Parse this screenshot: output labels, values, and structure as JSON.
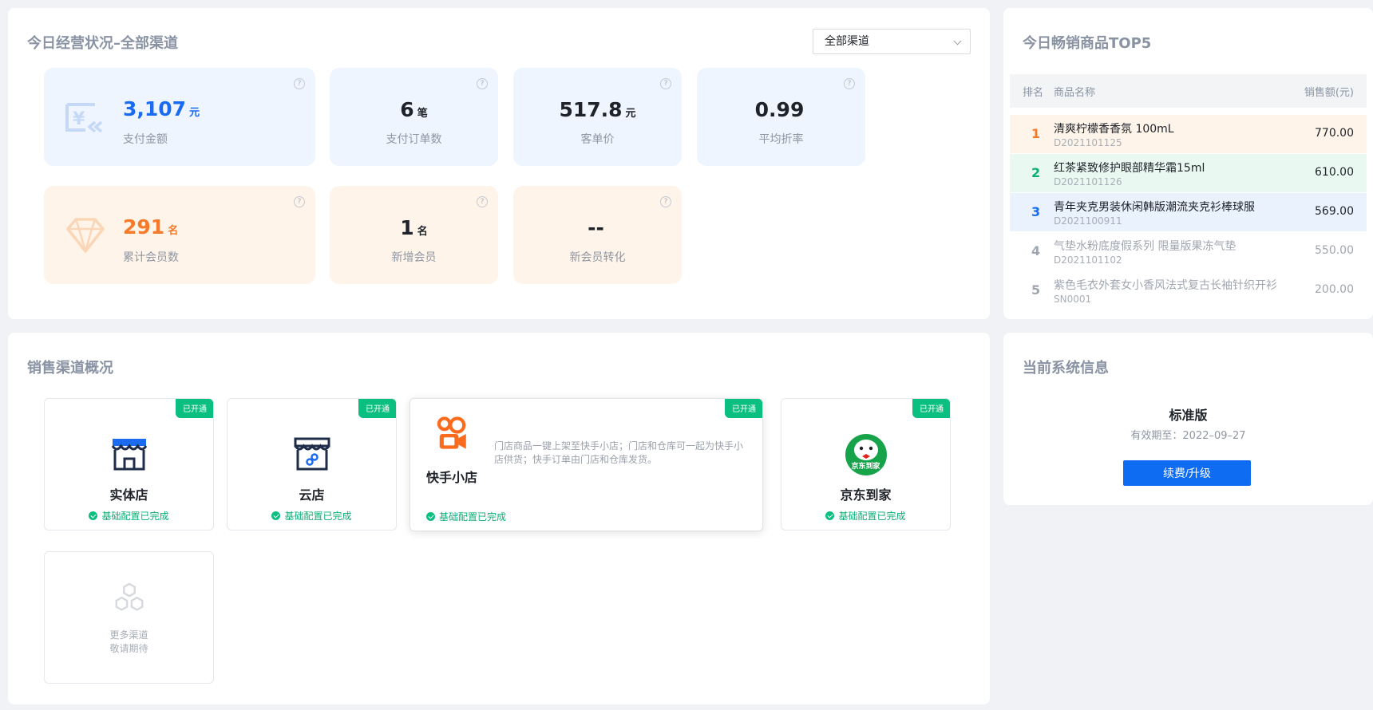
{
  "overview": {
    "title": "今日经营状况–全部渠道",
    "channel_select": {
      "value": "全部渠道"
    },
    "stats": [
      {
        "value": "3,107",
        "unit": "元",
        "label": "支付金额"
      },
      {
        "value": "6",
        "unit": "笔",
        "label": "支付订单数"
      },
      {
        "value": "517.8",
        "unit": "元",
        "label": "客单价"
      },
      {
        "value": "0.99",
        "unit": "",
        "label": "平均折率"
      },
      {
        "value": "291",
        "unit": "名",
        "label": "累计会员数"
      },
      {
        "value": "1",
        "unit": "名",
        "label": "新增会员"
      },
      {
        "value": "--",
        "unit": "",
        "label": "新会员转化"
      }
    ],
    "help_glyph": "?",
    "colors": {
      "blue_card": "#eef5fe",
      "orange_card": "#fff4ea",
      "blue_value": "#1a6bf0",
      "orange_value": "#f57a2a"
    }
  },
  "top5": {
    "title": "今日畅销商品TOP5",
    "headers": {
      "rank": "排名",
      "name": "商品名称",
      "amount": "销售额(元)"
    },
    "rows": [
      {
        "rank": "1",
        "name": "清爽柠檬香香氛 100mL",
        "code": "D2021101125",
        "amount": "770.00",
        "bg": "#fff4ea",
        "rank_color": "#f57a2a"
      },
      {
        "rank": "2",
        "name": "红茶紧致修护眼部精华霜15ml",
        "code": "D2021101126",
        "amount": "610.00",
        "bg": "#e9f8f1",
        "rank_color": "#0aaf74"
      },
      {
        "rank": "3",
        "name": "青年夹克男装休闲韩版潮流夹克衫棒球服",
        "code": "D2021100911",
        "amount": "569.00",
        "bg": "#eaf2fd",
        "rank_color": "#1a6bf0"
      },
      {
        "rank": "4",
        "name": "气垫水粉底度假系列 限量版果冻气垫",
        "code": "D2021101102",
        "amount": "550.00",
        "bg": "#ffffff",
        "rank_color": "#a0a6b0"
      },
      {
        "rank": "5",
        "name": "紫色毛衣外套女小香风法式复古长袖针织开衫",
        "code": "SN0001",
        "amount": "200.00",
        "bg": "#ffffff",
        "rank_color": "#a0a6b0"
      }
    ]
  },
  "channels": {
    "title": "销售渠道概况",
    "opened_tag": "已开通",
    "config_done": "基础配置已完成",
    "items": [
      {
        "name": "实体店",
        "icon": "storefront-icon"
      },
      {
        "name": "云店",
        "icon": "cloud-store-icon"
      },
      {
        "name": "快手小店",
        "icon": "kuaishou-logo-icon",
        "description": "门店商品一键上架至快手小店；门店和仓库可一起为快手小店供货；快手订单由门店和仓库发货。"
      },
      {
        "name": "京东到家",
        "icon": "jd-daojia-logo-icon",
        "logo_text": "京东到家"
      }
    ],
    "more": {
      "line1": "更多渠道",
      "line2": "敬请期待",
      "icon": "hexagon-cluster-icon"
    },
    "colors": {
      "tag": "#0abf7f",
      "ok": "#0aaf74"
    }
  },
  "system": {
    "title": "当前系统信息",
    "edition": "标准版",
    "expiry": "有效期至：2022–09–27",
    "renew_button": "续费/升级",
    "colors": {
      "button": "#0d6cf2"
    }
  }
}
